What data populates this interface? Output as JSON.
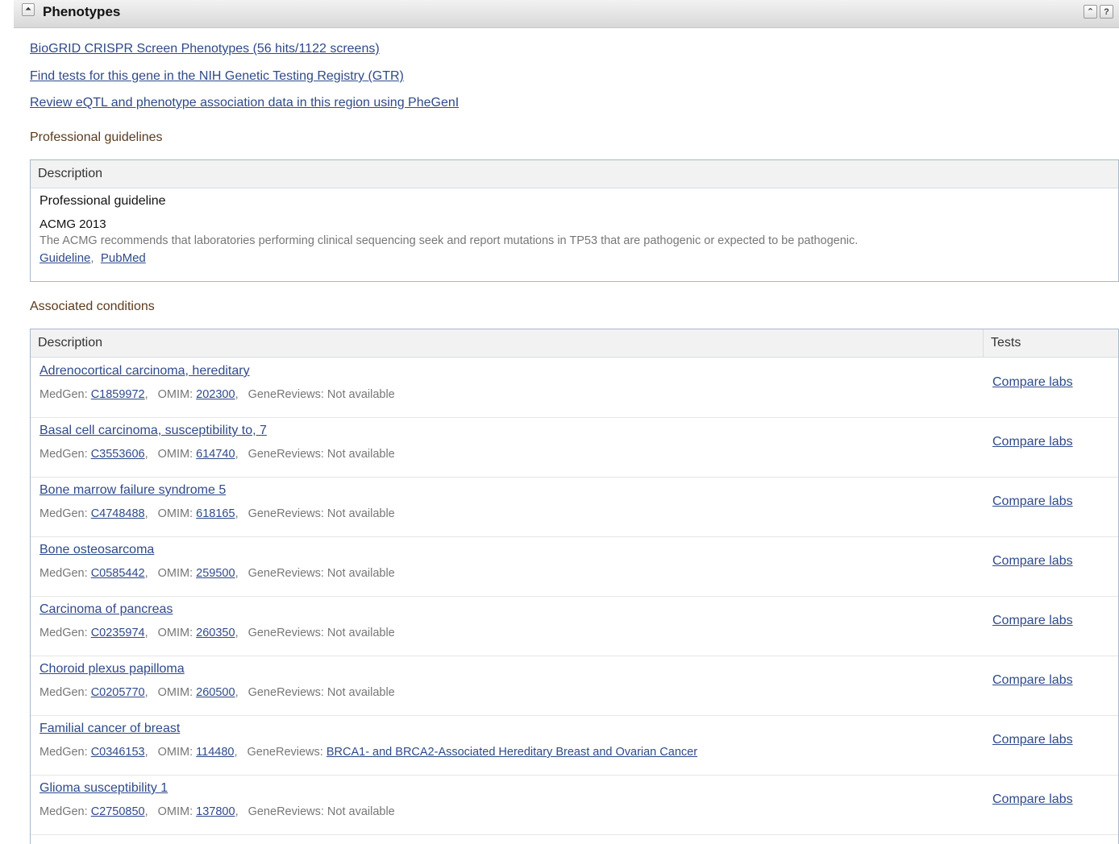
{
  "header": {
    "title": "Phenotypes",
    "collapse_icon": "⏶",
    "top_icon": "⌃",
    "help_icon": "?"
  },
  "links": [
    "BioGRID CRISPR Screen Phenotypes (56 hits/1122 screens)",
    "Find tests for this gene in the NIH Genetic Testing Registry (GTR)",
    "Review eQTL and phenotype association data in this region using PheGenI"
  ],
  "guidelines": {
    "heading": "Professional guidelines",
    "column": "Description",
    "title": "Professional guideline",
    "name": "ACMG 2013",
    "text": "The ACMG recommends that laboratories performing clinical sequencing seek and report mutations in TP53 that are pathogenic or expected to be pathogenic.",
    "link1": "Guideline",
    "link2": "PubMed"
  },
  "conditions": {
    "heading": "Associated conditions",
    "col_description": "Description",
    "col_tests": "Tests",
    "medgen_label": "MedGen:",
    "omim_label": "OMIM:",
    "genereviews_label": "GeneReviews:",
    "compare_label": "Compare labs",
    "rows": [
      {
        "name": "Adrenocortical carcinoma, hereditary",
        "medgen": "C1859972",
        "omim": "202300",
        "genereviews": "Not available",
        "genereviews_link": false
      },
      {
        "name": "Basal cell carcinoma, susceptibility to, 7",
        "medgen": "C3553606",
        "omim": "614740",
        "genereviews": "Not available",
        "genereviews_link": false
      },
      {
        "name": "Bone marrow failure syndrome 5",
        "medgen": "C4748488",
        "omim": "618165",
        "genereviews": "Not available",
        "genereviews_link": false
      },
      {
        "name": "Bone osteosarcoma",
        "medgen": "C0585442",
        "omim": "259500",
        "genereviews": "Not available",
        "genereviews_link": false
      },
      {
        "name": "Carcinoma of pancreas",
        "medgen": "C0235974",
        "omim": "260350",
        "genereviews": "Not available",
        "genereviews_link": false
      },
      {
        "name": "Choroid plexus papilloma",
        "medgen": "C0205770",
        "omim": "260500",
        "genereviews": "Not available",
        "genereviews_link": false
      },
      {
        "name": "Familial cancer of breast",
        "medgen": "C0346153",
        "omim": "114480",
        "genereviews": "BRCA1- and BRCA2-Associated Hereditary Breast and Ovarian Cancer",
        "genereviews_link": true
      },
      {
        "name": "Glioma susceptibility 1",
        "medgen": "C2750850",
        "omim": "137800",
        "genereviews": "Not available",
        "genereviews_link": false
      }
    ]
  }
}
